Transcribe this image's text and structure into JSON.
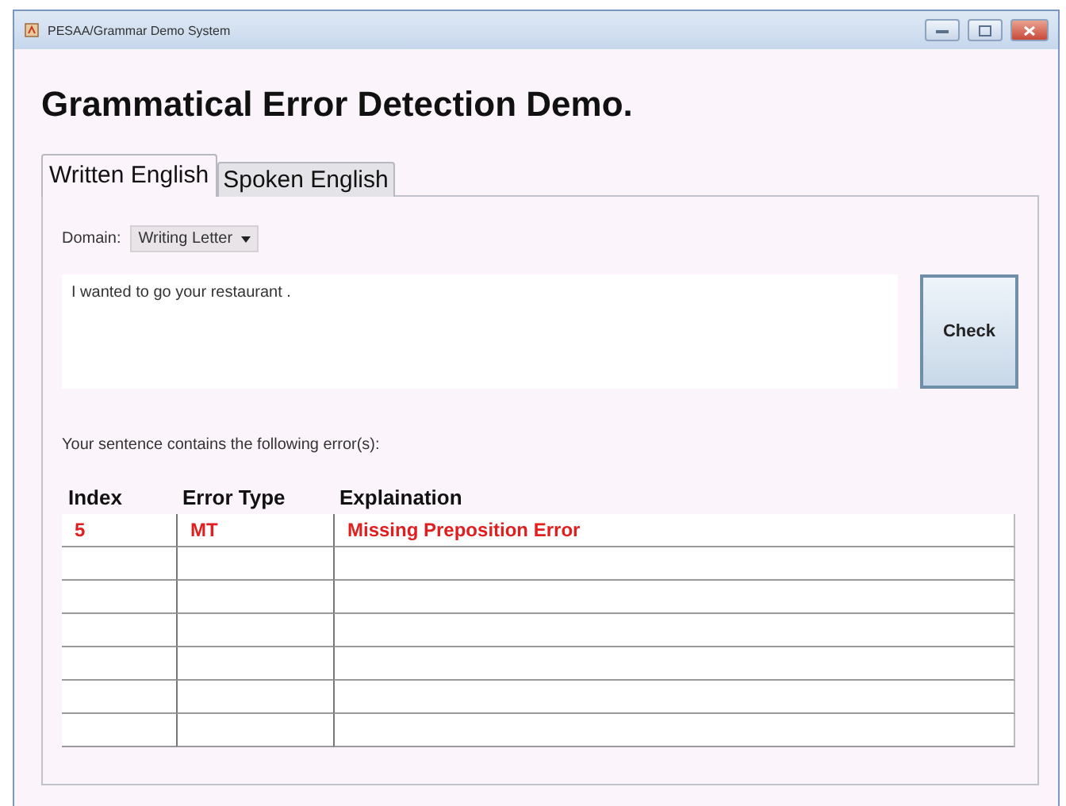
{
  "window": {
    "title": "PESAA/Grammar Demo System"
  },
  "heading": "Grammatical Error Detection Demo.",
  "tabs": [
    {
      "label": "Written English",
      "selected": true
    },
    {
      "label": "Spoken English",
      "selected": false
    }
  ],
  "domain": {
    "label": "Domain:",
    "value": "Writing Letter"
  },
  "sentence": {
    "value": "I wanted to go your restaurant ."
  },
  "check_button": "Check",
  "result_message": "Your sentence contains the following error(s):",
  "table": {
    "columns": [
      "Index",
      "Error Type",
      "Explaination"
    ],
    "rows": [
      [
        "5",
        "MT",
        "Missing Preposition Error"
      ]
    ]
  }
}
